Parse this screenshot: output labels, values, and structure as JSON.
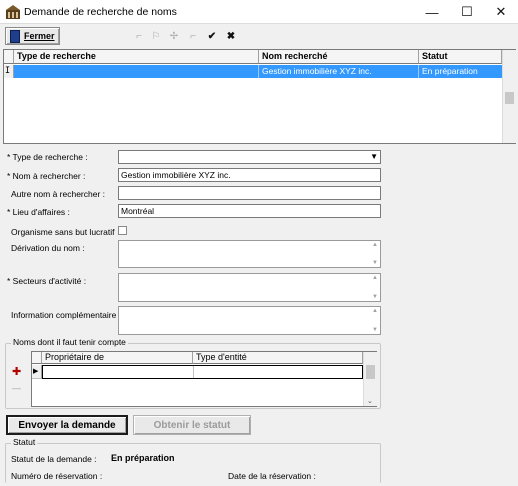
{
  "window": {
    "title": "Demande de recherche de noms",
    "minimize_glyph": "—",
    "maximize_glyph": "☐",
    "close_glyph": "✕"
  },
  "toolbar": {
    "fermer_label": "Fermer",
    "icons": [
      "first-record-icon",
      "flag-icon",
      "add-record-icon",
      "remove-record-icon",
      "save-check-icon",
      "cancel-x-icon"
    ]
  },
  "results_grid": {
    "columns": [
      "Type de recherche",
      "Nom recherché",
      "Statut"
    ],
    "rows": [
      {
        "type": "",
        "nom": "Gestion immobilière XYZ inc.",
        "statut": "En préparation"
      }
    ],
    "row_indicator": "I"
  },
  "form": {
    "type_recherche_label": "* Type de recherche :",
    "type_recherche_value": "",
    "nom_label": "* Nom à rechercher :",
    "nom_value": "Gestion immobilière XYZ inc.",
    "autre_nom_label": "Autre nom à rechercher :",
    "autre_nom_value": "",
    "lieu_label": "* Lieu d'affaires :",
    "lieu_value": "Montréal",
    "osbl_label": "Organisme sans but lucratif",
    "derivation_label": "Dérivation du nom :",
    "secteurs_label": "* Secteurs d'activité :",
    "info_label": "Information complémentaire :"
  },
  "noms_group": {
    "title": "Noms dont il faut tenir compte",
    "columns": [
      "Propriétaire de",
      "Type d'entité"
    ],
    "add_glyph": "✚",
    "remove_glyph": "—"
  },
  "actions": {
    "envoyer_label": "Envoyer la demande",
    "obtenir_label": "Obtenir le statut"
  },
  "statut_group": {
    "title": "Statut",
    "demande_label": "Statut de la demande :",
    "demande_value": "En préparation",
    "numero_label": "Numéro de réservation :",
    "numero_value": "",
    "date_label": "Date de la réservation :",
    "date_value": ""
  },
  "colors": {
    "selection": "#3399ff",
    "window_bg": "#f0f0f0"
  }
}
